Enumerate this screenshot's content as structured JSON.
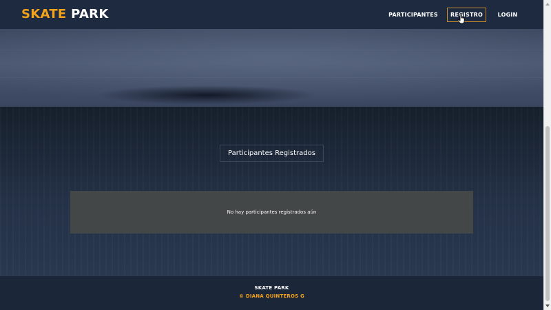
{
  "navbar": {
    "brand_primary": "SKATE",
    "brand_secondary": "PARK",
    "links": [
      {
        "label": "PARTICIPANTES"
      },
      {
        "label": "REGISTRO"
      },
      {
        "label": "LOGIN"
      }
    ]
  },
  "main": {
    "section_title": "Participantes Registrados",
    "empty_message": "No hay participantes registrados aún"
  },
  "footer": {
    "title": "SKATE PARK",
    "credit": "© DIANA QUINTEROS G"
  },
  "colors": {
    "accent": "#f3a21b",
    "navbar_bg": "#1d2a40",
    "empty_box_bg": "#444748"
  },
  "icons": {
    "cursor": "hand-pointer-icon"
  }
}
